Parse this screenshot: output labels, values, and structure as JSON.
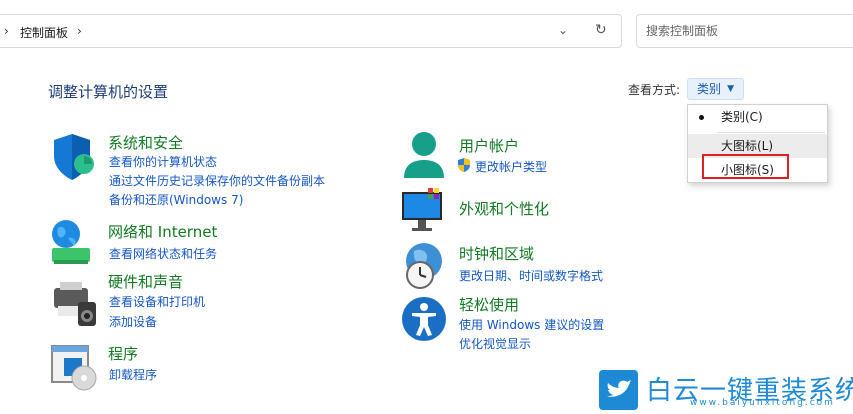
{
  "address_bar": {
    "crumb": "控制面板",
    "left_arrow": "›",
    "right_arrow": "›",
    "dropdown_glyph": "⌄",
    "refresh_glyph": "↻"
  },
  "search": {
    "placeholder": "搜索控制面板"
  },
  "page_title": "调整计算机的设置",
  "view_by": {
    "label": "查看方式:",
    "selected": "类别",
    "options": [
      "类别(C)",
      "大图标(L)",
      "小图标(S)"
    ],
    "highlighted_option": "小图标(S)",
    "highlight_color": "#e02020"
  },
  "categories": {
    "system_security": {
      "title": "系统和安全",
      "links": [
        "查看你的计算机状态",
        "通过文件历史记录保存你的文件备份副本",
        "备份和还原(Windows 7)"
      ]
    },
    "network": {
      "title": "网络和 Internet",
      "links": [
        "查看网络状态和任务"
      ]
    },
    "hardware": {
      "title": "硬件和声音",
      "links": [
        "查看设备和打印机",
        "添加设备"
      ]
    },
    "programs": {
      "title": "程序",
      "links": [
        "卸载程序"
      ]
    },
    "user_accounts": {
      "title": "用户帐户",
      "links": [
        "更改帐户类型"
      ]
    },
    "appearance": {
      "title": "外观和个性化",
      "links": []
    },
    "clock_region": {
      "title": "时钟和区域",
      "links": [
        "更改日期、时间或数字格式"
      ]
    },
    "ease_access": {
      "title": "轻松使用",
      "links": [
        "使用 Windows 建议的设置",
        "优化视觉显示"
      ]
    }
  },
  "colors": {
    "category_title": "#117a22",
    "link": "#1557c4",
    "page_title": "#1f3d7a",
    "watermark": "#1e8ad6"
  },
  "watermark": {
    "brand": "白云一键重装系统",
    "url": "www.baiyunxitong.com"
  }
}
